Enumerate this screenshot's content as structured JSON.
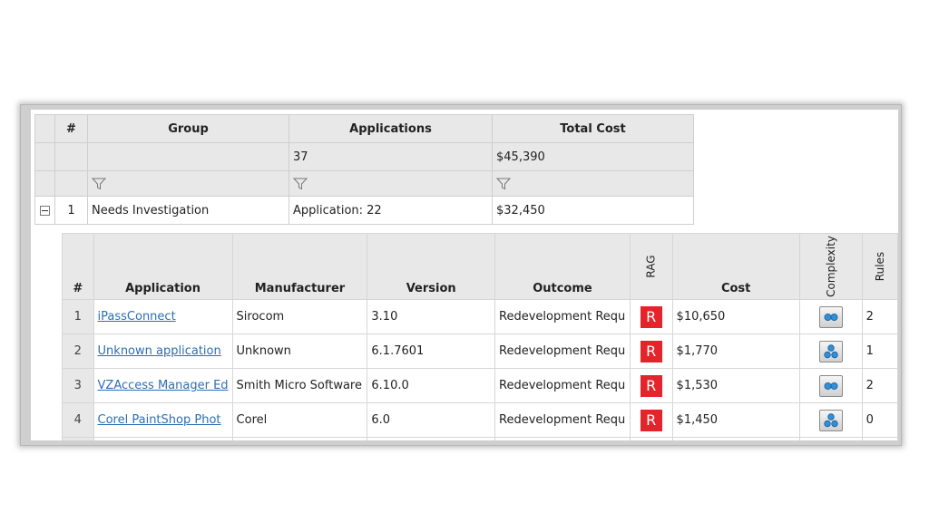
{
  "groups_table": {
    "columns": [
      "#",
      "Group",
      "Applications",
      "Total Cost"
    ],
    "summary": {
      "applications": "37",
      "total_cost": "$45,390"
    },
    "rows": [
      {
        "index": "1",
        "group": "Needs Investigation",
        "applications": "Application: 22",
        "total_cost": "$32,450"
      }
    ]
  },
  "detail_table": {
    "columns": [
      "#",
      "Application",
      "Manufacturer",
      "Version",
      "Outcome",
      "RAG",
      "Cost",
      "Complexity",
      "Rules"
    ],
    "rows": [
      {
        "index": "1",
        "application": "iPassConnect",
        "manufacturer": "Sirocom",
        "version": "3.10",
        "outcome": "Redevelopment Requ",
        "rag": "R",
        "cost": "$10,650",
        "complexity_icon": "two-dots-icon",
        "rules": "2"
      },
      {
        "index": "2",
        "application": "Unknown application",
        "manufacturer": "Unknown",
        "version": "6.1.7601",
        "outcome": "Redevelopment Requ",
        "rag": "R",
        "cost": "$1,770",
        "complexity_icon": "three-dots-icon",
        "rules": "1"
      },
      {
        "index": "3",
        "application": "VZAccess Manager Ed",
        "manufacturer": "Smith Micro Software",
        "version": "6.10.0",
        "outcome": "Redevelopment Requ",
        "rag": "R",
        "cost": "$1,530",
        "complexity_icon": "two-dots-icon",
        "rules": "2"
      },
      {
        "index": "4",
        "application": "Corel PaintShop Phot",
        "manufacturer": "Corel",
        "version": "6.0",
        "outcome": "Redevelopment Requ",
        "rag": "R",
        "cost": "$1,450",
        "complexity_icon": "three-dots-icon",
        "rules": "0"
      }
    ]
  },
  "colors": {
    "rag_red": "#e3242b",
    "link_blue": "#2a6fb5",
    "header_gray": "#e8e8e8"
  }
}
